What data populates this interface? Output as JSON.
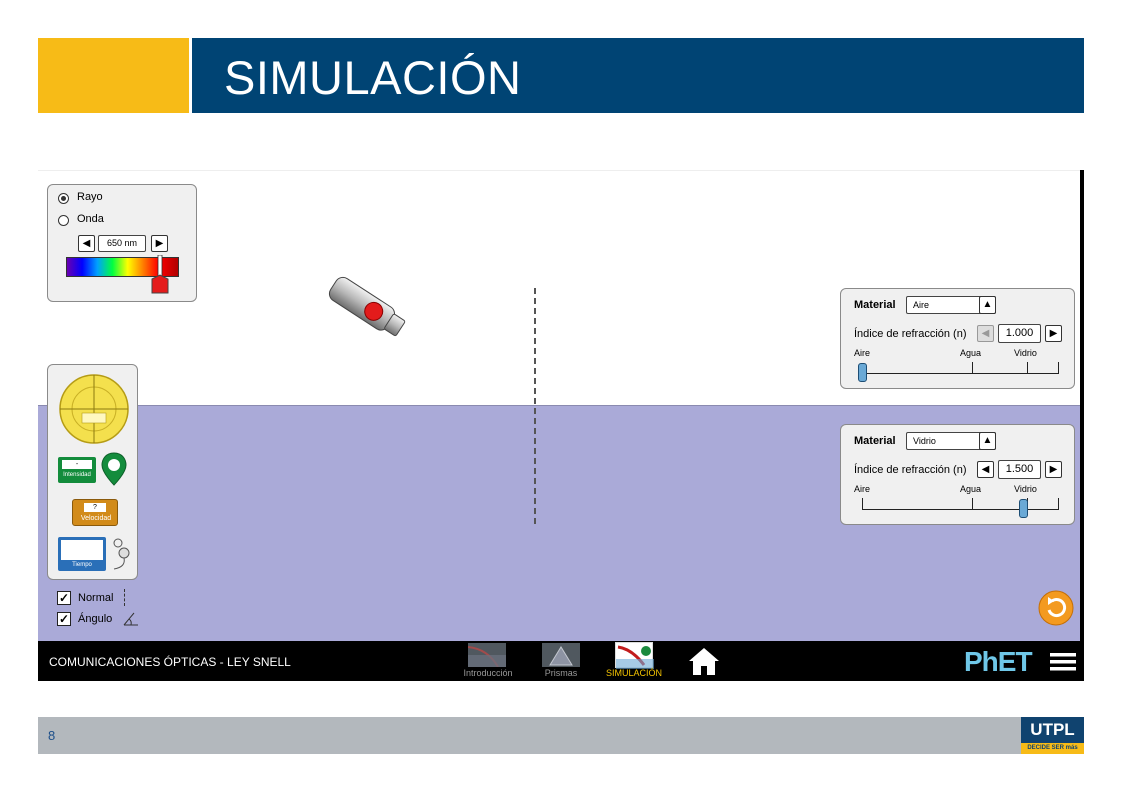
{
  "slide": {
    "title": "SIMULACIÓN",
    "page_number": "8",
    "logo_text": "UTPL",
    "logo_tagline": "DECIDE SER más",
    "colors": {
      "yellow": "#f7bb17",
      "blue": "#004474",
      "footer_gray": "#b3b8bd"
    }
  },
  "sim": {
    "mode_panel": {
      "options": [
        "Rayo",
        "Onda"
      ],
      "selected": "Rayo",
      "wavelength": "650 nm"
    },
    "tools": {
      "intensity_label": "Intensidad",
      "intensity_value": "-",
      "velocity_label": "Velocidad",
      "velocity_value": "?",
      "time_label": "Tiempo"
    },
    "checkboxes": [
      {
        "label": "Normal",
        "checked": true
      },
      {
        "label": "Ángulo",
        "checked": true
      }
    ],
    "top_medium": {
      "material_label": "Material",
      "material": "Aire",
      "index_label": "Índice de refracción (n)",
      "index_value": "1.000",
      "ticks": [
        "Aire",
        "Agua",
        "Vidrio"
      ],
      "level": 0.0
    },
    "bottom_medium": {
      "material_label": "Material",
      "material": "Vidrio",
      "index_label": "Índice de refracción (n)",
      "index_value": "1.500",
      "ticks": [
        "Aire",
        "Agua",
        "Vidrio"
      ],
      "level": 0.82
    },
    "navbar": {
      "title": "COMUNICACIONES ÓPTICAS - LEY SNELL",
      "tabs": [
        {
          "label": "Introducción",
          "active": false
        },
        {
          "label": "Prismas",
          "active": false
        },
        {
          "label": "SIMULACIÓN",
          "active": true
        }
      ],
      "brand": "PhET"
    }
  }
}
